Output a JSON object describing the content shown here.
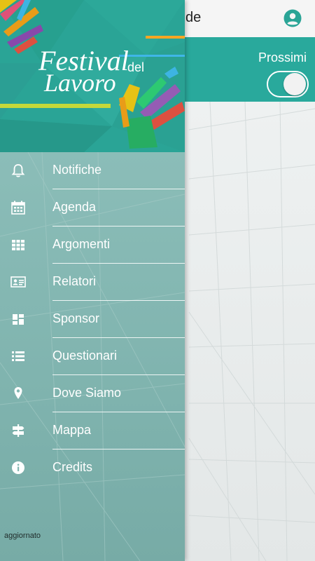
{
  "appbar": {
    "title": "de",
    "account_icon": "account-circle-icon"
  },
  "filter": {
    "label": "Prossimi",
    "toggle_on": true
  },
  "header": {
    "logo_line1": "Festival",
    "logo_small": "del",
    "logo_line2": "Lavoro"
  },
  "menu": [
    {
      "label": "Notifiche",
      "icon": "bell-icon"
    },
    {
      "label": "Agenda",
      "icon": "calendar-icon"
    },
    {
      "label": "Argomenti",
      "icon": "grid-icon"
    },
    {
      "label": "Relatori",
      "icon": "id-card-icon"
    },
    {
      "label": "Sponsor",
      "icon": "dashboard-icon"
    },
    {
      "label": "Questionari",
      "icon": "list-icon"
    },
    {
      "label": "Dove Siamo",
      "icon": "map-pin-icon"
    },
    {
      "label": "Mappa",
      "icon": "signpost-icon"
    },
    {
      "label": "Credits",
      "icon": "info-icon"
    }
  ],
  "footer": {
    "status_text": "aggiornato"
  },
  "colors": {
    "teal": "#29a99c",
    "drawer_bg": "#83b7b2"
  }
}
